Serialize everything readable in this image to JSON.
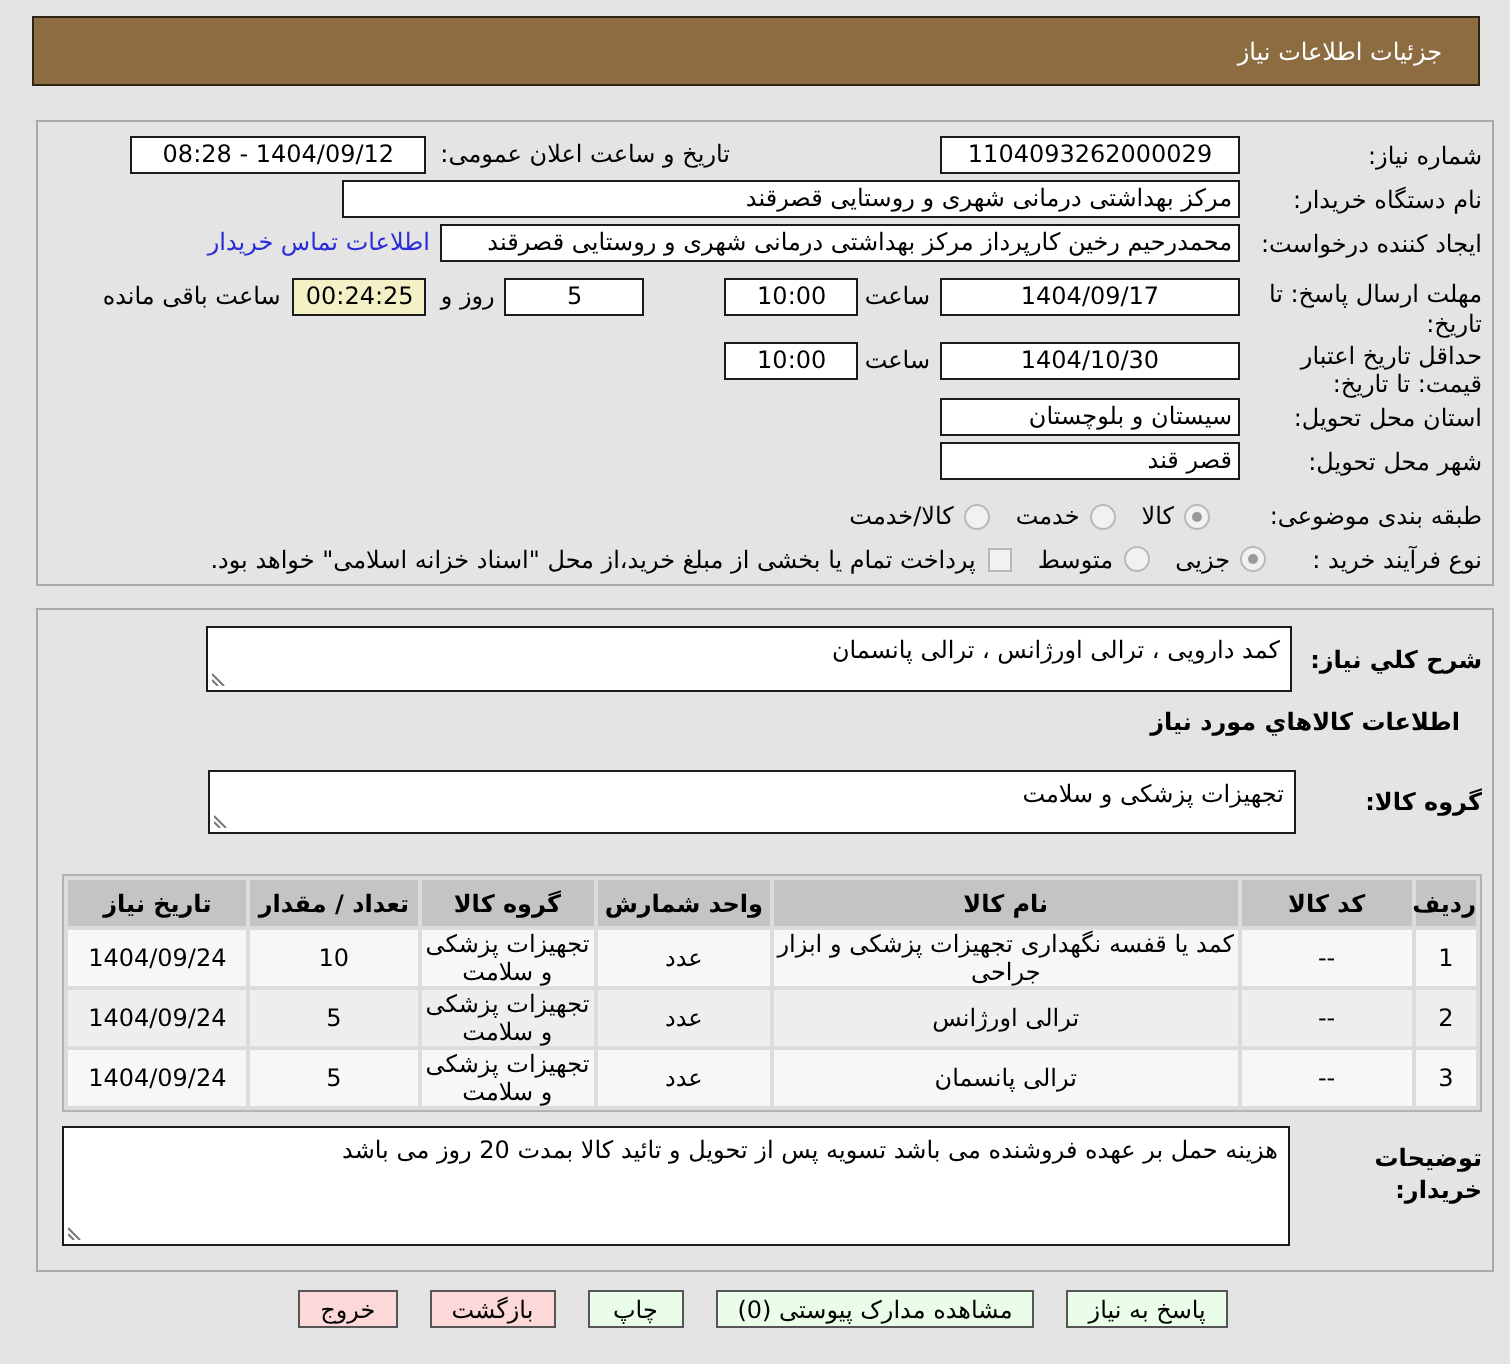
{
  "header": {
    "title": "جزئیات اطلاعات نیاز"
  },
  "need_info": {
    "need_number": {
      "label": "شماره نیاز:",
      "value": "1104093262000029"
    },
    "announcement": {
      "label": "تاریخ و ساعت اعلان عمومی:",
      "value": "1404/09/12 - 08:28"
    },
    "buyer_organization": {
      "label": "نام دستگاه خریدار:",
      "value": "مرکز بهداشتی درمانی شهری و روستایی قصرقند"
    },
    "requester": {
      "label": "ایجاد کننده درخواست:",
      "value": "محمدرحیم رخین کارپرداز مرکز بهداشتی درمانی شهری و روستایی قصرقند",
      "link": "اطلاعات تماس خریدار"
    },
    "response_deadline": {
      "label": "مهلت ارسال پاسخ: تا تاریخ:",
      "date": "1404/09/17",
      "time_label": "ساعت",
      "time": "10:00",
      "days": "5",
      "days_label": "روز و",
      "remaining": "00:24:25",
      "remaining_label": "ساعت باقی مانده"
    },
    "price_validity": {
      "label": "حداقل تاریخ اعتبار قیمت: تا تاریخ:",
      "date": "1404/10/30",
      "time_label": "ساعت",
      "time": "10:00"
    },
    "delivery_province": {
      "label": "استان محل تحویل:",
      "value": "سیستان و بلوچستان"
    },
    "delivery_city": {
      "label": "شهر محل تحویل:",
      "value": "قصر قند"
    },
    "subject_category": {
      "label": "طبقه بندی موضوعی:",
      "options": [
        {
          "label": "کالا",
          "selected": true,
          "disabled": true
        },
        {
          "label": "خدمت",
          "selected": false,
          "disabled": true
        },
        {
          "label": "کالا/خدمت",
          "selected": false,
          "disabled": true
        }
      ]
    },
    "purchase_process": {
      "label": "نوع فرآیند خرید :",
      "options": [
        {
          "label": "جزیی",
          "selected": true,
          "disabled": true
        },
        {
          "label": "متوسط",
          "selected": false,
          "disabled": true
        }
      ],
      "treasury_payment": {
        "label": "پرداخت تمام یا بخشی از مبلغ خرید،از محل \"اسناد خزانه اسلامی\" خواهد بود.",
        "checked": false,
        "disabled": true
      }
    }
  },
  "items": {
    "description": {
      "label": "شرح کلي نیاز:",
      "value": "کمد دارویی ، ترالی اورژانس ، ترالی پانسمان"
    },
    "section_title": "اطلاعات کالاهاي مورد نیاز",
    "goods_group": {
      "label": "گروه کالا:",
      "value": "تجهیزات پزشکی و سلامت"
    },
    "table": {
      "columns": [
        "ردیف",
        "کد کالا",
        "نام کالا",
        "واحد شمارش",
        "گروه کالا",
        "تعداد / مقدار",
        "تاریخ نیاز"
      ],
      "rows": [
        {
          "cells": [
            "1",
            "--",
            "کمد یا قفسه نگهداری تجهیزات پزشکی و ابزار جراحی",
            "عدد",
            "تجهیزات پزشکی و سلامت",
            "10",
            "1404/09/24"
          ]
        },
        {
          "cells": [
            "2",
            "--",
            "ترالی اورژانس",
            "عدد",
            "تجهیزات پزشکی و سلامت",
            "5",
            "1404/09/24"
          ]
        },
        {
          "cells": [
            "3",
            "--",
            "ترالی پانسمان",
            "عدد",
            "تجهیزات پزشکی و سلامت",
            "5",
            "1404/09/24"
          ]
        }
      ]
    },
    "buyer_notes": {
      "label": "توضیحات خریدار:",
      "value": "هزینه حمل بر عهده فروشنده می باشد تسویه پس از تحویل و تائید کالا بمدت 20 روز می باشد"
    }
  },
  "buttons": [
    {
      "label": "پاسخ به نیاز",
      "kind": "confirm"
    },
    {
      "label": "مشاهده مدارک پیوستی (0)",
      "kind": "confirm"
    },
    {
      "label": "چاپ",
      "kind": "confirm"
    },
    {
      "label": "بازگشت",
      "kind": "cancel"
    },
    {
      "label": "خروج",
      "kind": "cancel"
    }
  ]
}
